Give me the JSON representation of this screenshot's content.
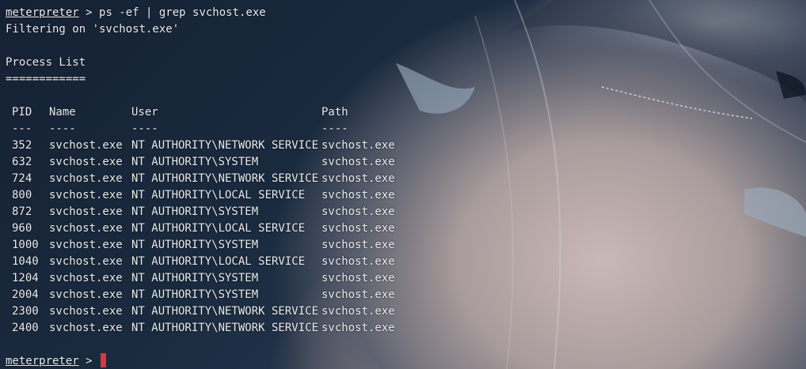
{
  "terminal": {
    "command_prompt": "meterpreter",
    "command_separator": " > ",
    "command": "ps -ef | grep svchost.exe",
    "filter_message": "Filtering on 'svchost.exe'",
    "section_title": "Process List",
    "section_underline": "============",
    "final_prompt": "meterpreter",
    "final_separator": " > "
  },
  "process_table": {
    "headers": {
      "pid": "PID",
      "name": "Name",
      "user": "User",
      "path": "Path"
    },
    "dividers": {
      "pid": "---",
      "name": "----",
      "user": "----",
      "path": "----"
    },
    "rows": [
      {
        "pid": "352",
        "name": "svchost.exe",
        "user": "NT AUTHORITY\\NETWORK SERVICE",
        "path": "svchost.exe"
      },
      {
        "pid": "632",
        "name": "svchost.exe",
        "user": "NT AUTHORITY\\SYSTEM",
        "path": "svchost.exe"
      },
      {
        "pid": "724",
        "name": "svchost.exe",
        "user": "NT AUTHORITY\\NETWORK SERVICE",
        "path": "svchost.exe"
      },
      {
        "pid": "800",
        "name": "svchost.exe",
        "user": "NT AUTHORITY\\LOCAL SERVICE",
        "path": "svchost.exe"
      },
      {
        "pid": "872",
        "name": "svchost.exe",
        "user": "NT AUTHORITY\\SYSTEM",
        "path": "svchost.exe"
      },
      {
        "pid": "960",
        "name": "svchost.exe",
        "user": "NT AUTHORITY\\LOCAL SERVICE",
        "path": "svchost.exe"
      },
      {
        "pid": "1000",
        "name": "svchost.exe",
        "user": "NT AUTHORITY\\SYSTEM",
        "path": "svchost.exe"
      },
      {
        "pid": "1040",
        "name": "svchost.exe",
        "user": "NT AUTHORITY\\LOCAL SERVICE",
        "path": "svchost.exe"
      },
      {
        "pid": "1204",
        "name": "svchost.exe",
        "user": "NT AUTHORITY\\SYSTEM",
        "path": "svchost.exe"
      },
      {
        "pid": "2004",
        "name": "svchost.exe",
        "user": "NT AUTHORITY\\SYSTEM",
        "path": "svchost.exe"
      },
      {
        "pid": "2300",
        "name": "svchost.exe",
        "user": "NT AUTHORITY\\NETWORK SERVICE",
        "path": "svchost.exe"
      },
      {
        "pid": "2400",
        "name": "svchost.exe",
        "user": "NT AUTHORITY\\NETWORK SERVICE",
        "path": "svchost.exe"
      }
    ]
  },
  "colors": {
    "text": "#e8eaec",
    "cursor": "#d8373b"
  }
}
